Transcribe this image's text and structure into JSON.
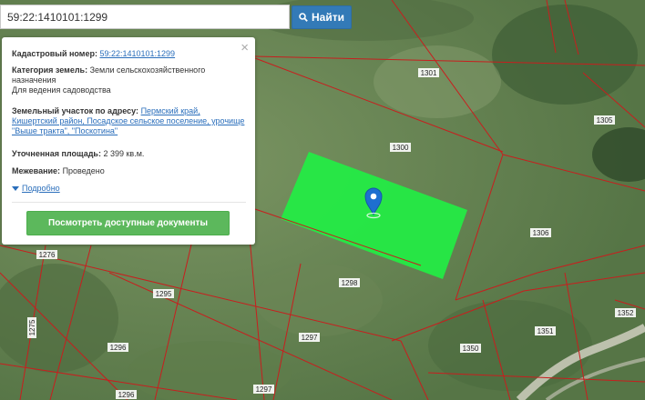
{
  "search": {
    "value": "59:22:1410101:1299",
    "button_label": "Найти"
  },
  "popup": {
    "cadastral_label": "Кадастровый номер:",
    "cadastral_value": "59:22:1410101:1299",
    "category_label": "Категория земель:",
    "category_value": "Земли сельскохозяйственного назначения",
    "usage_value": "Для ведения садоводства",
    "address_label": "Земельный участок по адресу:",
    "address_value": "Пермский край, Кишертский район, Посадское сельское поселение, урочище \"Выше тракта\", \"Поскотина\"",
    "area_label": "Уточненная площадь:",
    "area_value": "2 399 кв.м.",
    "survey_label": "Межевание:",
    "survey_value": "Проведено",
    "details_link": "Подробно",
    "docs_button": "Посмотреть доступные документы"
  },
  "map": {
    "parcel_labels": [
      "1301",
      "1300",
      "1305",
      "1306",
      "1298",
      "1295",
      "1276",
      "1297",
      "1296",
      "1275",
      "1350",
      "1351",
      "1352",
      "1296",
      "1297"
    ],
    "colors": {
      "highlight": "#22ee44",
      "boundary": "#c81e1e",
      "marker": "#1e6fd0",
      "road": "#cfcfc0"
    }
  }
}
